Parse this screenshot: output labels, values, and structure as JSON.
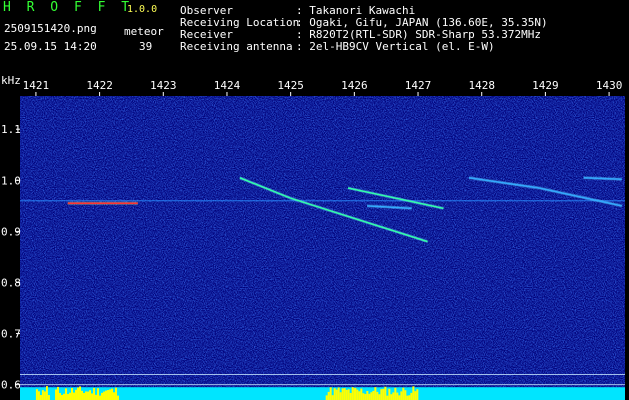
{
  "app": {
    "title": "H R O F F T",
    "version": "1.0.0",
    "filename": "2509151420.png",
    "datetime": "25.09.15 14:20",
    "meteor_label": "meteor",
    "meteor_count": "39"
  },
  "station": {
    "rows": [
      {
        "label": "Observer",
        "value": ": Takanori Kawachi"
      },
      {
        "label": "Receiving Location",
        "value": ": Ogaki, Gifu, JAPAN (136.60E, 35.35N)"
      },
      {
        "label": "Receiver",
        "value": ": R820T2(RTL-SDR) SDR-Sharp 53.372MHz"
      },
      {
        "label": "Receiving antenna",
        "value": ": 2el-HB9CV Vertical (el. E-W)"
      }
    ]
  },
  "colors": {
    "background": "#000000",
    "spectrogram_base": "#00007a",
    "header_green": "#33ff33",
    "header_white": "#ffffff",
    "header_yellow": "#ffff55",
    "band_cyan": "#00e5ff",
    "band_yellow": "#ffff00"
  },
  "chart_data": {
    "type": "heatmap",
    "ylabel": "kHz",
    "x_ticks": [
      "1421",
      "1422",
      "1423",
      "1424",
      "1425",
      "1426",
      "1427",
      "1428",
      "1429",
      "1430"
    ],
    "x_range": [
      1420.75,
      1430.25
    ],
    "y_ticks": [
      "1.1",
      "1.0",
      "0.9",
      "0.8",
      "0.7",
      "0.6"
    ],
    "y_values": [
      1.1,
      1.0,
      0.9,
      0.8,
      0.7,
      0.6
    ],
    "y_range": [
      0.57,
      1.165
    ],
    "carrier_khz": 0.96,
    "meteor_traces": [
      {
        "from": [
          1421.5,
          0.955
        ],
        "to": [
          1422.6,
          0.955
        ],
        "intensity": "high"
      },
      {
        "from": [
          1424.2,
          1.005
        ],
        "to": [
          1425.0,
          0.965
        ],
        "intensity": "medium"
      },
      {
        "from": [
          1425.0,
          0.965
        ],
        "to": [
          1427.15,
          0.88
        ],
        "intensity": "medium"
      },
      {
        "from": [
          1425.9,
          0.985
        ],
        "to": [
          1427.4,
          0.945
        ],
        "intensity": "medium"
      },
      {
        "from": [
          1426.2,
          0.95
        ],
        "to": [
          1426.9,
          0.945
        ],
        "intensity": "low"
      },
      {
        "from": [
          1427.8,
          1.005
        ],
        "to": [
          1428.9,
          0.985
        ],
        "intensity": "low"
      },
      {
        "from": [
          1428.9,
          0.985
        ],
        "to": [
          1430.2,
          0.95
        ],
        "intensity": "low"
      },
      {
        "from": [
          1429.6,
          1.005
        ],
        "to": [
          1430.2,
          1.002
        ],
        "intensity": "low"
      }
    ],
    "reference_lines_khz": [
      0.62,
      0.6
    ]
  }
}
